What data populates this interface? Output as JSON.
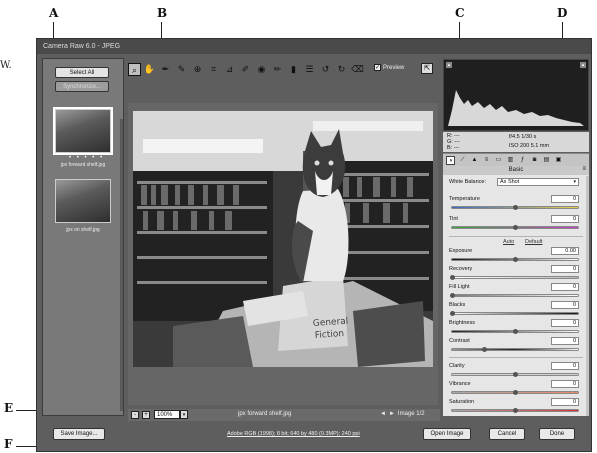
{
  "callouts": {
    "a": "A",
    "b": "B",
    "c": "C",
    "d": "D",
    "e": "E",
    "f": "F"
  },
  "stray_text": "W.",
  "window": {
    "title": "Camera Raw 6.0  -  JPEG"
  },
  "filmstrip": {
    "select_all": "Select All",
    "synchronize": "Synchronize...",
    "rating_dots": "• • • • •",
    "items": [
      {
        "caption": "jpx forward shelf.jpg"
      },
      {
        "caption": "jpx on shelf.jpg"
      }
    ]
  },
  "toolbar": {
    "tools": [
      "zoom-tool",
      "hand-tool",
      "white-balance-tool",
      "color-sampler-tool",
      "targeted-adjustment-tool",
      "crop-tool",
      "straighten-tool",
      "spot-removal-tool",
      "red-eye-tool",
      "adjustment-brush-tool",
      "graduated-filter-tool",
      "preferences-tool",
      "rotate-ccw-tool",
      "rotate-cw-tool",
      "trash-tool"
    ],
    "preview_label": "Preview"
  },
  "photo": {
    "sign_line1": "General",
    "sign_line2": "Fiction"
  },
  "status": {
    "minus": "-",
    "plus": "+",
    "zoom_value": "100%",
    "zoom_dropdown": "▾",
    "filename": "jpx forward shelf.jpg",
    "prev": "◄",
    "next": "►",
    "image_count": "Image 1/2"
  },
  "footer": {
    "save_image": "Save Image...",
    "workflow_link": "Adobe RGB (1998); 8 bit; 640 by 480 (0.3MP); 240 ppi",
    "open_image": "Open Image",
    "cancel": "Cancel",
    "done": "Done"
  },
  "readout": {
    "r": "R:   ---",
    "g": "G:   ---",
    "b": "B:   ---",
    "exif_line1": "f/4.5   1/30 s",
    "exif_line2": "ISO 200   5.1 mm"
  },
  "panel": {
    "title": "Basic",
    "white_balance_label": "White Balance:",
    "white_balance_value": "As Shot",
    "auto_link": "Auto",
    "default_link": "Default",
    "sliders": [
      {
        "label": "Temperature",
        "value": "0",
        "position": 0.5
      },
      {
        "label": "Tint",
        "value": "0",
        "position": 0.5
      },
      {
        "label": "Exposure",
        "value": "0.00",
        "position": 0.5
      },
      {
        "label": "Recovery",
        "value": "0",
        "position": 0.0
      },
      {
        "label": "Fill Light",
        "value": "0",
        "position": 0.0
      },
      {
        "label": "Blacks",
        "value": "0",
        "position": 0.0
      },
      {
        "label": "Brightness",
        "value": "0",
        "position": 0.5
      },
      {
        "label": "Contrast",
        "value": "0",
        "position": 0.25
      },
      {
        "label": "Clarity",
        "value": "0",
        "position": 0.5
      },
      {
        "label": "Vibrance",
        "value": "0",
        "position": 0.5
      },
      {
        "label": "Saturation",
        "value": "0",
        "position": 0.5
      }
    ]
  },
  "colors": {
    "window_bg": "#5e5e5e",
    "panel_bg": "#e6e6e6",
    "histogram_bg": "#1f1f1f"
  }
}
